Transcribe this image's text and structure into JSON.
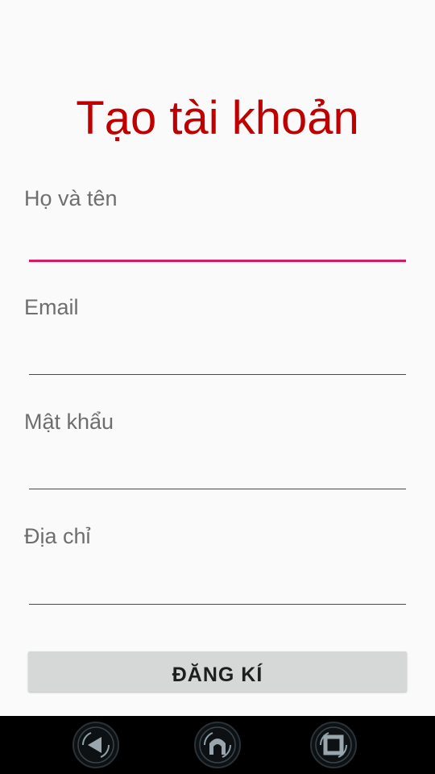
{
  "page": {
    "title": "Tạo tài khoản"
  },
  "form": {
    "fields": [
      {
        "label": "Họ và tên",
        "value": "",
        "focused": true
      },
      {
        "label": "Email",
        "value": ""
      },
      {
        "label": "Mật khẩu",
        "value": ""
      },
      {
        "label": "Địa chỉ",
        "value": ""
      }
    ],
    "submit_label": "ĐĂNG KÍ"
  },
  "navbar": {
    "buttons": [
      "back-icon",
      "home-icon",
      "recent-apps-icon"
    ]
  },
  "colors": {
    "title": "#c00000",
    "focus_underline": "#d81b60",
    "label": "#6e6e6e",
    "button_bg": "#d6d7d7",
    "navbar_bg": "#000000"
  }
}
